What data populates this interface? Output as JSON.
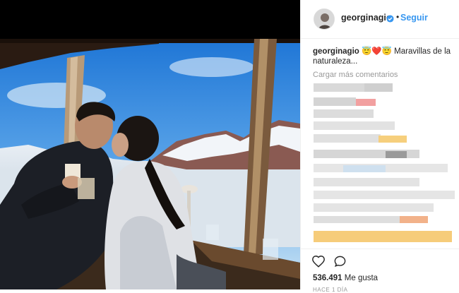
{
  "post": {
    "username": "georginagio",
    "follow_label": "Seguir",
    "separator": "•",
    "caption_user": "georginagio",
    "caption_emojis": "😇❤️😇",
    "caption_text": " Maravillas de la naturaleza...",
    "load_more": "Cargar más comentarios",
    "likes_count": "536.491",
    "likes_label": " Me gusta",
    "time_ago": "HACE 1 DÍA"
  },
  "colors": {
    "accent": "#3897f0",
    "text": "#262626",
    "muted": "#999999"
  },
  "icons": {
    "verified": "verified-badge-icon",
    "like": "heart-icon",
    "comment": "comment-icon"
  }
}
